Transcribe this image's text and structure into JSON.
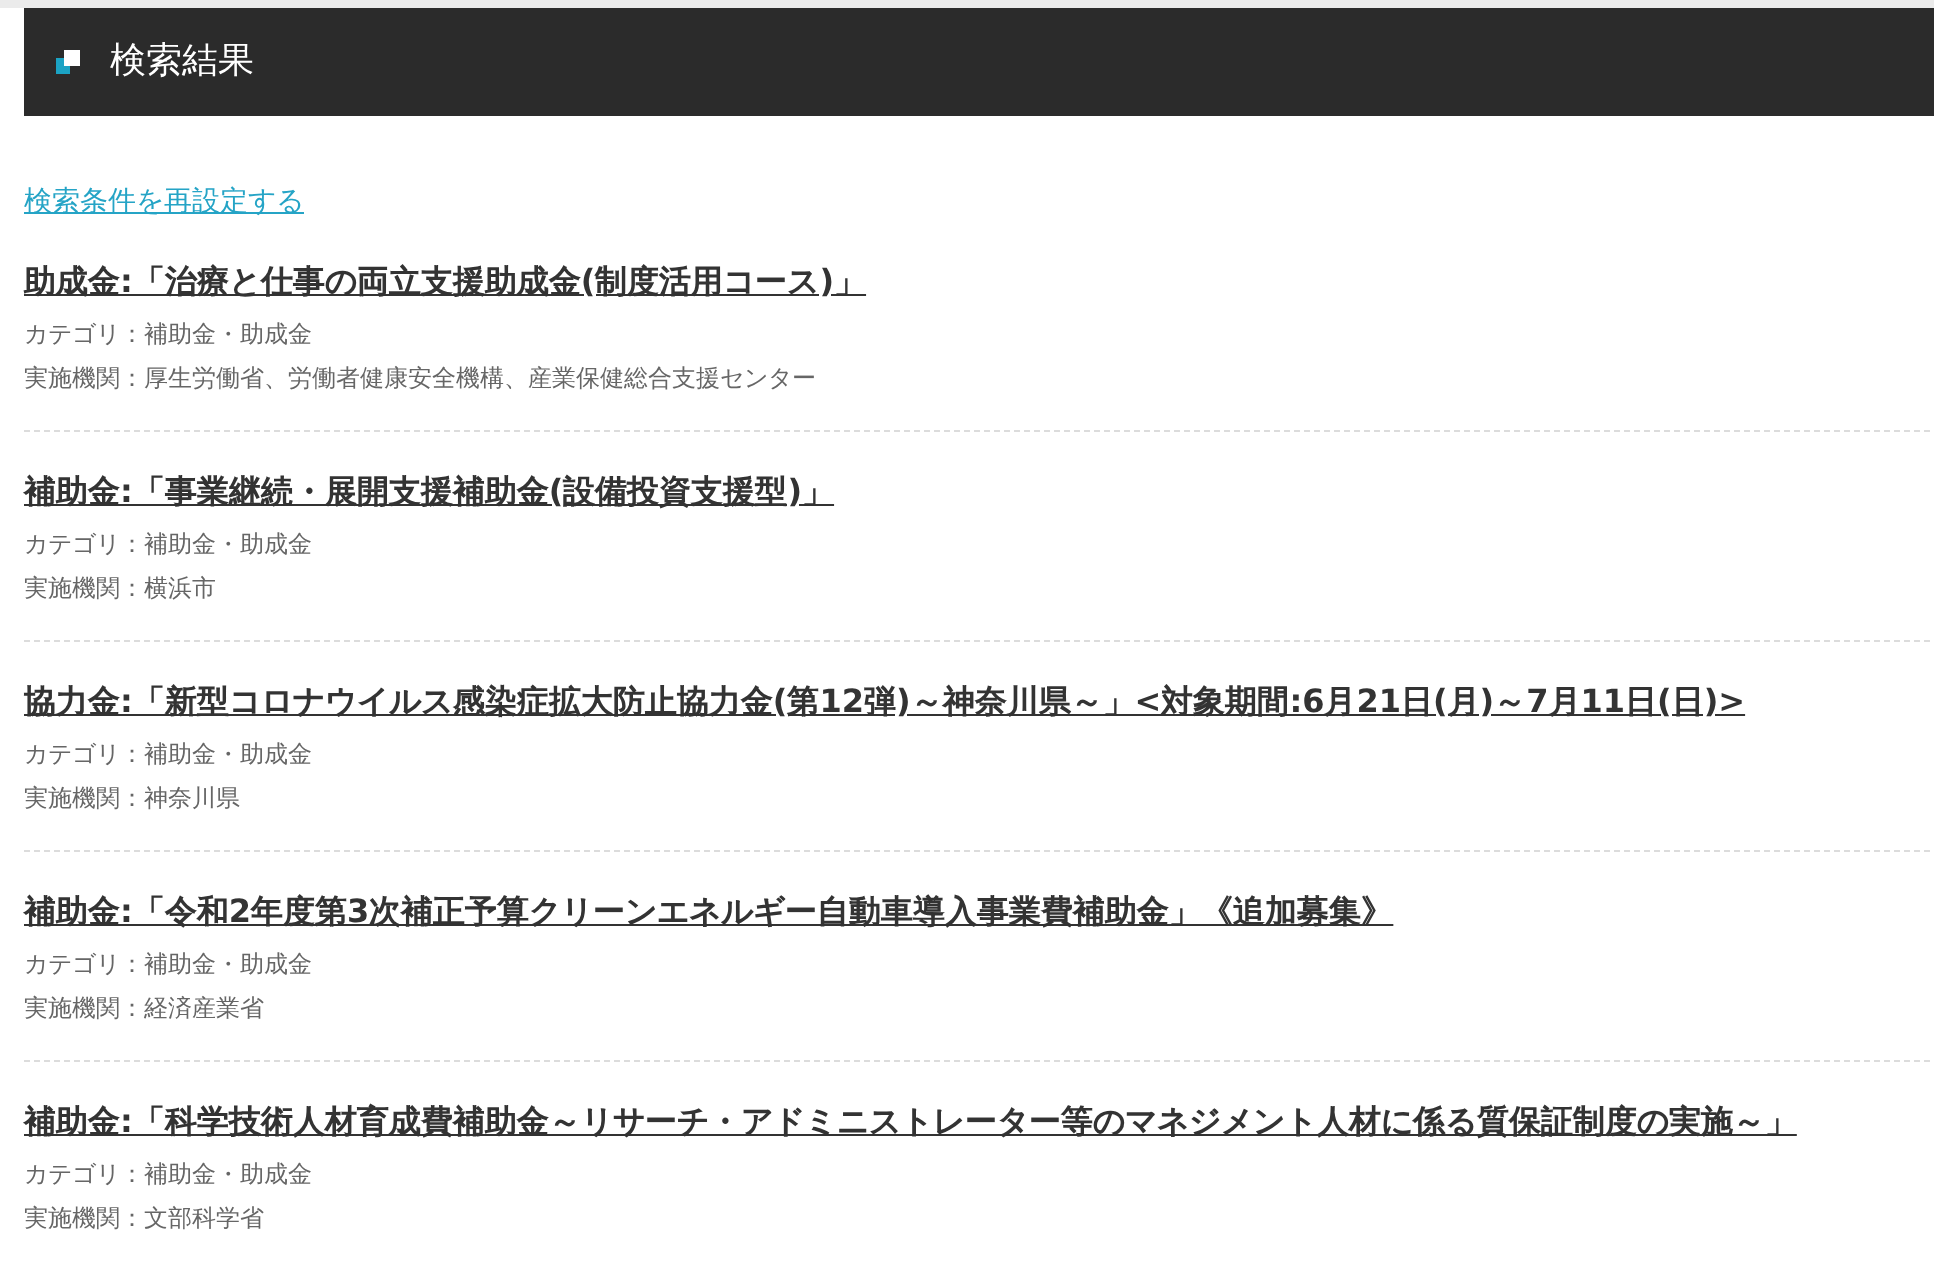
{
  "header": {
    "title": "検索結果"
  },
  "reset_link": "検索条件を再設定する",
  "results": [
    {
      "title": "助成金:「治療と仕事の両立支援助成金(制度活用コース)」",
      "category": "カテゴリ：補助金・助成金",
      "agency": "実施機関：厚生労働省、労働者健康安全機構、産業保健総合支援センター"
    },
    {
      "title": "補助金:「事業継続・展開支援補助金(設備投資支援型)」",
      "category": "カテゴリ：補助金・助成金",
      "agency": "実施機関：横浜市"
    },
    {
      "title": "協力金:「新型コロナウイルス感染症拡大防止協力金(第12弾)～神奈川県～」<対象期間:6月21日(月)～7月11日(日)>",
      "category": "カテゴリ：補助金・助成金",
      "agency": "実施機関：神奈川県"
    },
    {
      "title": "補助金:「令和2年度第3次補正予算クリーンエネルギー自動車導入事業費補助金」《追加募集》",
      "category": "カテゴリ：補助金・助成金",
      "agency": "実施機関：経済産業省"
    },
    {
      "title": "補助金:「科学技術人材育成費補助金～リサーチ・アドミニストレーター等のマネジメント人材に係る質保証制度の実施～」",
      "category": "カテゴリ：補助金・助成金",
      "agency": "実施機関：文部科学省"
    }
  ]
}
